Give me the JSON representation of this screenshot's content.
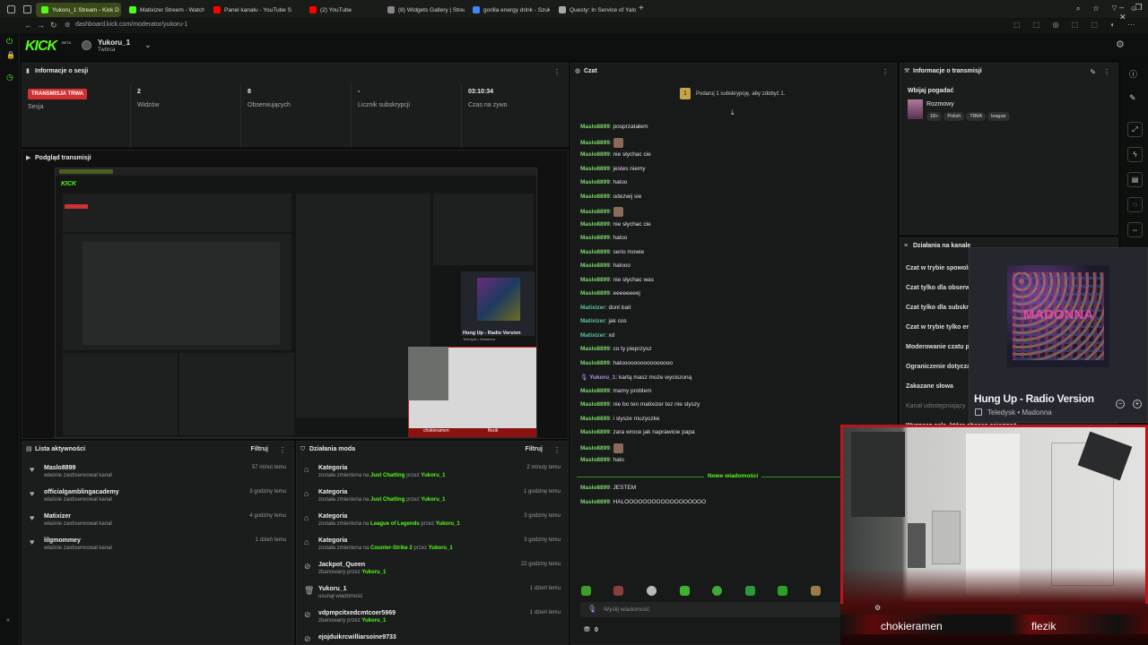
{
  "browser": {
    "tabs": [
      {
        "label": "Yukoru_1 Stream - Kick D",
        "color": "#53fc18",
        "active": true
      },
      {
        "label": "Matixizer Streem - Watch",
        "color": "#53fc18"
      },
      {
        "label": "Panel kanału - YouTube S",
        "color": "#ff0000"
      },
      {
        "label": "(2) YouTube",
        "color": "#ff0000"
      },
      {
        "label": "(8) Widgets Gallery | Strea",
        "color": "#888888"
      },
      {
        "label": "gorilla energy drink - Szuk",
        "color": "#4285f4"
      },
      {
        "label": "Questy: In Service of Yalo",
        "color": "#aaaaaa"
      }
    ],
    "url": "dashboard.kick.com/moderator/yukoru-1",
    "add_tab": "+"
  },
  "header": {
    "logo": "KICK",
    "beta": "BETA",
    "channel": "Yukoru_1",
    "role": "Twórca"
  },
  "session": {
    "title": "Informacje o sesji",
    "live_badge": "TRANSMISJA TRWA",
    "live_label": "Sesja",
    "viewers_value": "2",
    "viewers_label": "Widzów",
    "followers_value": "8",
    "followers_label": "Obserwujących",
    "subs_value": "-",
    "subs_label": "Licznik subskrypcji",
    "time_value": "03:10:34",
    "time_label": "Czas na żywo"
  },
  "preview": {
    "title": "Podgląd transmisji",
    "overlay_song": "Hung Up - Radio Version",
    "overlay_sub": "Teledysk • Madonna",
    "cam_left": "chokieramen",
    "cam_right": "flezik"
  },
  "chat": {
    "title": "Czat",
    "sub_prompt": "Podaruj 1 subskrypcję, aby zdobyć 1.",
    "messages": [
      {
        "user": "Maslo8899",
        "text": "posprzatałem",
        "cls": "un"
      },
      {
        "user": "Maslo8899",
        "text": "",
        "cls": "un",
        "emote": true
      },
      {
        "user": "Maslo8899",
        "text": "nie słychac cie",
        "cls": "un"
      },
      {
        "user": "Maslo8899",
        "text": "jestes niemy",
        "cls": "un"
      },
      {
        "user": "Maslo8899",
        "text": "haloo",
        "cls": "un"
      },
      {
        "user": "Maslo8899",
        "text": "odezwij sie",
        "cls": "un"
      },
      {
        "user": "Maslo8899",
        "text": "",
        "cls": "un",
        "emote": true
      },
      {
        "user": "Maslo8899",
        "text": "nie słychac cie",
        "cls": "un"
      },
      {
        "user": "Maslo8899",
        "text": "haloo",
        "cls": "un"
      },
      {
        "user": "Maslo8899",
        "text": "serio mowie",
        "cls": "un"
      },
      {
        "user": "Maslo8899",
        "text": "halooo",
        "cls": "un"
      },
      {
        "user": "Maslo8899",
        "text": "nie słychac was",
        "cls": "un"
      },
      {
        "user": "Maslo8899",
        "text": "eeeeeeeej",
        "cls": "un"
      },
      {
        "user": "Matixizer",
        "text": "dont bait",
        "cls": "un2"
      },
      {
        "user": "Matixizer",
        "text": "jak cos",
        "cls": "un2"
      },
      {
        "user": "Matixizer",
        "text": "xd",
        "cls": "un2"
      },
      {
        "user": "Maslo8899",
        "text": "co ty pieprzysz",
        "cls": "un"
      },
      {
        "user": "Maslo8899",
        "text": "haloooooooooooooooo",
        "cls": "un"
      },
      {
        "user": "Yukoru_1",
        "text": "kartą masz może wyciszoną",
        "cls": "un3"
      },
      {
        "user": "Maslo8899",
        "text": "mamy problem",
        "cls": "un"
      },
      {
        "user": "Maslo8899",
        "text": "nie bo ten matixizer tez nie slyszy",
        "cls": "un"
      },
      {
        "user": "Maslo8899",
        "text": "i slysze muzyczke",
        "cls": "un"
      },
      {
        "user": "Maslo8899",
        "text": "zara wroce jak naprawicie papa",
        "cls": "un"
      },
      {
        "user": "Maslo8899",
        "text": "",
        "cls": "un",
        "emote": true
      },
      {
        "user": "Maslo8899",
        "text": "halo",
        "cls": "un"
      }
    ],
    "new_messages": "Nowe wiadomości",
    "messages_after": [
      {
        "user": "Maslo8899",
        "text": "JESTEM",
        "cls": "un"
      },
      {
        "user": "Maslo8899",
        "text": "HALOOOOOOOOOOOOOOOOOO",
        "cls": "un"
      }
    ],
    "input_placeholder": "Wyślij wiadomość",
    "points": "0"
  },
  "stream_info": {
    "title": "Informacje o transmisji",
    "stream_title": "Wbijaj pogadać",
    "category": "Rozmowy",
    "tags": [
      "18+",
      "Polish",
      "TIBIA",
      "league"
    ]
  },
  "channel_actions": {
    "title": "Działania na kanale",
    "items": [
      "Czat w trybie spowolnienia",
      "Czat tylko dla obserwujących",
      "Czat tylko dla subskrybentów",
      "Czat w trybie tylko emotek",
      "Moderowanie czatu przez AI",
      "Ograniczenie dotyczące kont",
      "Zakazane słowa",
      "Kanał udostępniający",
      "Wyznacz cele, które chcesz osiągnąć"
    ]
  },
  "music_widget": {
    "title": "Hung Up - Radio Version",
    "sub": "Teledysk • Madonna",
    "art_text": "MADONNA"
  },
  "webcam": {
    "left_name": "chokieramen",
    "right_name": "flezik"
  },
  "activity": {
    "title": "Lista aktywności",
    "filter": "Filtruj",
    "items": [
      {
        "name": "Maslo8899",
        "action": "właśnie zaobserwował kanał",
        "time": "57 minut temu"
      },
      {
        "name": "officialgamblingacademy",
        "action": "właśnie zaobserwował kanał",
        "time": "3 godziny temu"
      },
      {
        "name": "Matixizer",
        "action": "właśnie zaobserwował kanał",
        "time": "4 godziny temu"
      },
      {
        "name": "lilgmommey",
        "action": "właśnie zaobserwował kanał",
        "time": "1 dzień temu"
      }
    ]
  },
  "mod_actions": {
    "title": "Działania moda",
    "filter": "Filtruj",
    "items": [
      {
        "name": "Kategoria",
        "pre": "została zmieniona na",
        "target": "Just Chatting",
        "by": "przez",
        "who": "Yukoru_1",
        "time": "2 minuty temu",
        "icon": "⌂"
      },
      {
        "name": "Kategoria",
        "pre": "została zmieniona na",
        "target": "Just Chatting",
        "by": "przez",
        "who": "Yukoru_1",
        "time": "1 godzinę temu",
        "icon": "⌂"
      },
      {
        "name": "Kategoria",
        "pre": "została zmieniona na",
        "target": "League of Legends",
        "by": "przez",
        "who": "Yukoru_1",
        "time": "3 godziny temu",
        "icon": "⌂"
      },
      {
        "name": "Kategoria",
        "pre": "została zmieniona na",
        "target": "Counter-Strike 2",
        "by": "przez",
        "who": "Yukoru_1",
        "time": "3 godziny temu",
        "icon": "⌂"
      },
      {
        "name": "Jackpot_Queen",
        "pre": "zbanowany przez",
        "target": "",
        "by": "",
        "who": "Yukoru_1",
        "time": "22 godziny temu",
        "icon": "⊘"
      },
      {
        "name": "Yukoru_1",
        "pre": "usunął wiadomość",
        "target": "",
        "by": "",
        "who": "",
        "time": "1 dzień temu",
        "icon": "🗑"
      },
      {
        "name": "vdpmpcitxedcmtcoer5969",
        "pre": "zbanowany przez",
        "target": "",
        "by": "",
        "who": "Yukoru_1",
        "time": "1 dzień temu",
        "icon": "⊘"
      },
      {
        "name": "ejojduikrcwilliarsoine9733",
        "pre": "",
        "target": "",
        "by": "",
        "who": "",
        "time": "",
        "icon": "⊘"
      }
    ]
  }
}
